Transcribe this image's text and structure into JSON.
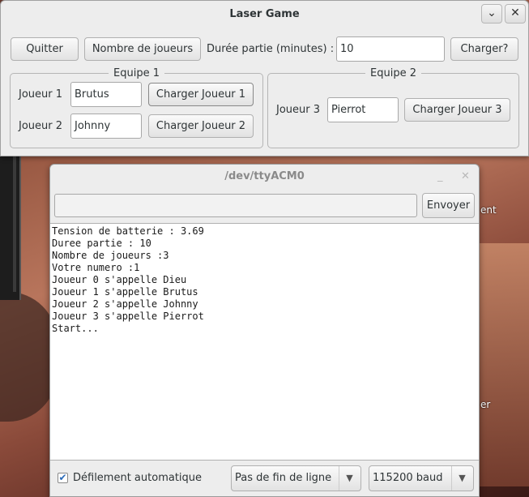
{
  "main_window": {
    "title": "Laser Game",
    "minimize_glyph": "⌄",
    "close_glyph": "✕",
    "toolbar": {
      "quit_label": "Quitter",
      "players_count_label": "Nombre de joueurs",
      "duration_label": "Durée partie (minutes) :",
      "duration_value": "10",
      "load_label": "Charger?"
    },
    "team1": {
      "title": "Equipe 1",
      "players": [
        {
          "label": "Joueur 1",
          "name": "Brutus",
          "load_label": "Charger Joueur 1"
        },
        {
          "label": "Joueur 2",
          "name": "Johnny",
          "load_label": "Charger Joueur 2"
        }
      ]
    },
    "team2": {
      "title": "Equipe 2",
      "players": [
        {
          "label": "Joueur 3",
          "name": "Pierrot",
          "load_label": "Charger Joueur 3"
        }
      ]
    }
  },
  "serial_monitor": {
    "title": "/dev/ttyACM0",
    "minimize_glyph": "_",
    "close_glyph": "✕",
    "input_value": "",
    "send_label": "Envoyer",
    "console_lines": [
      "Tension de batterie : 3.69",
      "Duree partie : 10",
      "Nombre de joueurs :3",
      "Votre numero :1",
      "Joueur 0 s'appelle Dieu",
      "Joueur 1 s'appelle Brutus",
      "Joueur 2 s'appelle Johnny",
      "Joueur 3 s'appelle Pierrot",
      "Start..."
    ],
    "autoscroll_label": "Défilement automatique",
    "autoscroll_checked": true,
    "line_ending": "Pas de fin de ligne",
    "baud_rate": "115200 baud"
  },
  "desktop": {
    "peek_text_1": "ent",
    "peek_text_2": "er"
  },
  "colors": {
    "window_bg": "#ededed",
    "checkbox_accent": "#2a6ab8"
  }
}
